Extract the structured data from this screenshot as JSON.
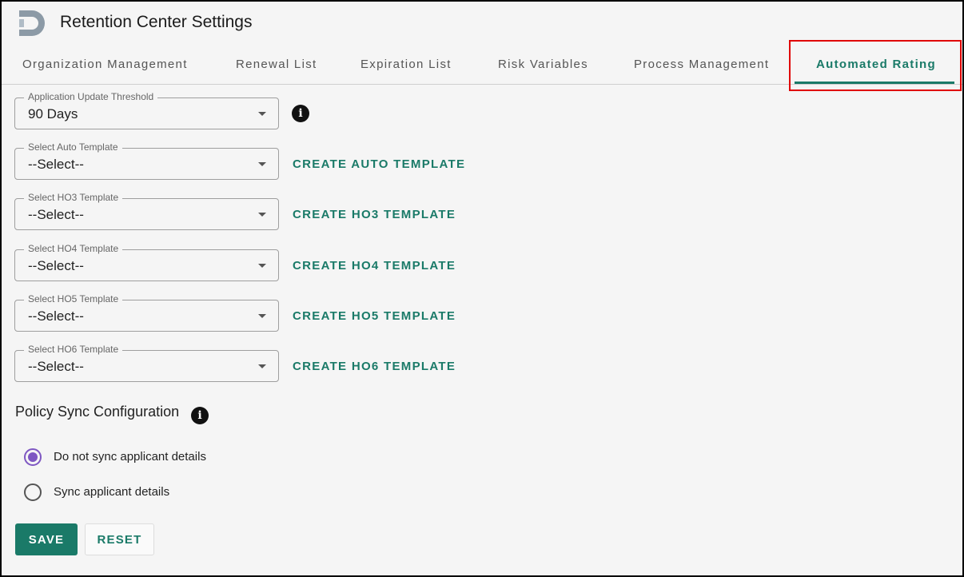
{
  "app": {
    "title": "Retention Center Settings",
    "logo": "logo-icon"
  },
  "tabs": [
    {
      "label": "Organization Management",
      "active": false
    },
    {
      "label": "Renewal List",
      "active": false
    },
    {
      "label": "Expiration List",
      "active": false
    },
    {
      "label": "Risk Variables",
      "active": false
    },
    {
      "label": "Process Management",
      "active": false
    },
    {
      "label": "Automated Rating",
      "active": true
    }
  ],
  "threshold": {
    "label": "Application Update Threshold",
    "value": "90 Days",
    "info_icon": "info-icon"
  },
  "templates": [
    {
      "label": "Select Auto Template",
      "value": "--Select--",
      "link": "CREATE AUTO TEMPLATE"
    },
    {
      "label": "Select HO3 Template",
      "value": "--Select--",
      "link": "CREATE HO3 TEMPLATE"
    },
    {
      "label": "Select HO4 Template",
      "value": "--Select--",
      "link": "CREATE HO4 TEMPLATE"
    },
    {
      "label": "Select HO5 Template",
      "value": "--Select--",
      "link": "CREATE HO5 TEMPLATE"
    },
    {
      "label": "Select HO6 Template",
      "value": "--Select--",
      "link": "CREATE HO6 TEMPLATE"
    }
  ],
  "policy_sync": {
    "title": "Policy Sync Configuration",
    "options": [
      {
        "label": "Do not sync applicant details",
        "selected": true
      },
      {
        "label": "Sync applicant details",
        "selected": false
      }
    ]
  },
  "actions": {
    "save_label": "SAVE",
    "reset_label": "RESET"
  },
  "colors": {
    "accent": "#1a7a68",
    "radio_selected": "#7e57c2",
    "highlight": "#e00000"
  }
}
